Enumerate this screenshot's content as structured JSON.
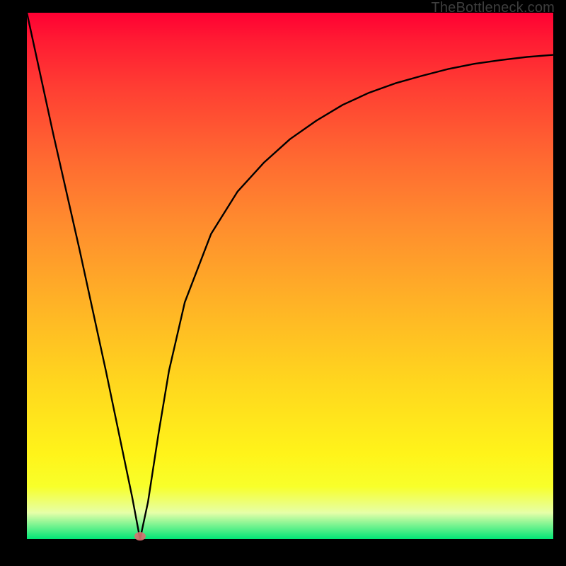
{
  "watermark": "TheBottleneck.com",
  "chart_data": {
    "type": "line",
    "title": "",
    "xlabel": "",
    "ylabel": "",
    "xlim": [
      0,
      100
    ],
    "ylim": [
      0,
      100
    ],
    "grid": false,
    "legend": false,
    "series": [
      {
        "name": "bottleneck-curve",
        "x": [
          0,
          5,
          10,
          15,
          20,
          21.5,
          23,
          25,
          27,
          30,
          35,
          40,
          45,
          50,
          55,
          60,
          65,
          70,
          75,
          80,
          85,
          90,
          95,
          100
        ],
        "y": [
          100,
          77,
          55,
          32,
          8,
          0,
          7,
          20,
          32,
          45,
          58,
          66,
          71.5,
          76,
          79.5,
          82.5,
          84.8,
          86.6,
          88,
          89.3,
          90.3,
          91,
          91.6,
          92
        ]
      }
    ],
    "marker": {
      "name": "trough-marker",
      "x": 21.5,
      "y": 0,
      "color": "#d97070"
    },
    "background_gradient": {
      "top": "#ff0033",
      "bottom": "#00e676"
    }
  }
}
